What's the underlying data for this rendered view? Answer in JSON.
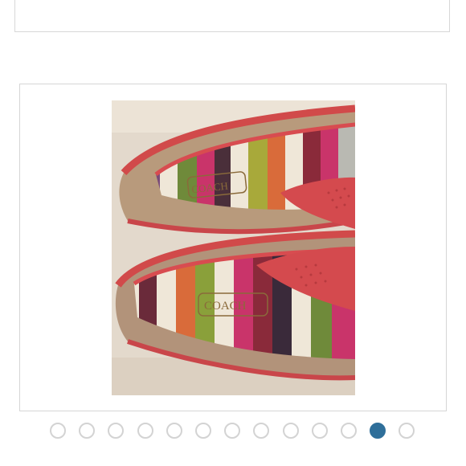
{
  "gallery": {
    "image_count": 13,
    "active_index": 11,
    "active_color": "#2f6f9a",
    "inactive_color": "#d3d3d3"
  },
  "photo": {
    "subject": "coach-striped-flats",
    "logo_text": "COACH"
  }
}
